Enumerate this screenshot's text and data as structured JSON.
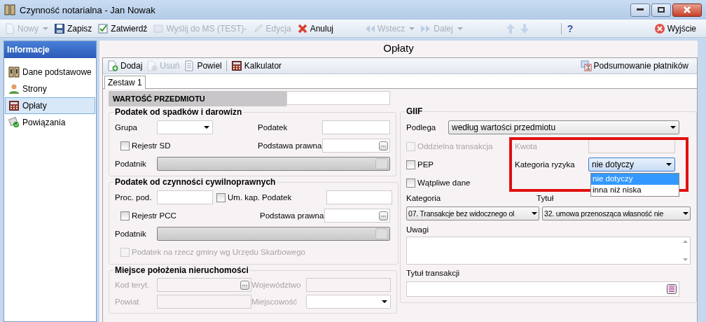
{
  "window": {
    "title": "Czynność notarialna - Jan Nowak"
  },
  "toolbar": {
    "items": [
      {
        "kind": "new",
        "label": "Nowy",
        "disabled": true,
        "dropdown": true
      },
      {
        "kind": "save",
        "label": "Zapisz",
        "disabled": false,
        "dropdown": false
      },
      {
        "kind": "approve",
        "label": "Zatwierdź",
        "disabled": false,
        "dropdown": false
      },
      {
        "kind": "send",
        "label": "Wyślij do MS (TEST)-",
        "disabled": true,
        "dropdown": false
      },
      {
        "kind": "edit",
        "label": "Edycja",
        "disabled": true,
        "dropdown": false
      },
      {
        "kind": "cancel",
        "label": "Anuluj",
        "disabled": false,
        "dropdown": false
      },
      {
        "kind": "back",
        "label": "Wstecz",
        "disabled": true,
        "dropdown": true
      },
      {
        "kind": "forward",
        "label": "Dalej",
        "disabled": true,
        "dropdown": true
      },
      {
        "kind": "up",
        "disabled": true,
        "dropdown": false
      },
      {
        "kind": "down",
        "disabled": true,
        "dropdown": false
      }
    ],
    "help": "?",
    "exit": "Wyjście"
  },
  "sidebar": {
    "title": "Informacje",
    "items": [
      {
        "kind": "docs",
        "label": "Dane podstawowe",
        "selected": false
      },
      {
        "kind": "person",
        "label": "Strony",
        "selected": false
      },
      {
        "kind": "calc",
        "label": "Opłaty",
        "selected": true
      },
      {
        "kind": "link",
        "label": "Powiązania",
        "selected": false
      }
    ]
  },
  "page": {
    "title": "Opłaty",
    "toolbar": [
      {
        "kind": "add",
        "label": "Dodaj",
        "disabled": false
      },
      {
        "kind": "remove",
        "label": "Usuń",
        "disabled": true
      },
      {
        "kind": "copy",
        "label": "Powiel",
        "disabled": false
      },
      {
        "kind": "calc",
        "label": "Kalkulator",
        "disabled": false
      }
    ],
    "summary": "Podsumowanie płatników",
    "tabs": [
      {
        "label": "Zestaw 1",
        "selected": true
      }
    ]
  },
  "subject_value": {
    "label": "WARTOŚĆ PRZEDMIOTU"
  },
  "inheritance_tax": {
    "title": "Podatek od spadków i darowizn",
    "group_label": "Grupa",
    "tax_label": "Podatek",
    "register": {
      "label": "Rejestr SD",
      "checked": false
    },
    "legal_basis_label": "Podstawa prawna",
    "taxpayer_label": "Podatnik"
  },
  "civil_tax": {
    "title": "Podatek od czynności cywilnoprawnych",
    "rate_label": "Proc. pod.",
    "capital": {
      "label": "Um. kap.",
      "checked": false
    },
    "tax_label": "Podatek",
    "register": {
      "label": "Rejestr PCC",
      "checked": false
    },
    "legal_basis_label": "Podstawa prawna",
    "taxpayer_label": "Podatnik",
    "municipality": {
      "label": "Podatek na rzecz gminy wg Urzędu Skarbowego",
      "checked": false,
      "disabled": true
    }
  },
  "property_location": {
    "title": "Miejsce położenia nieruchomości",
    "disabled": true,
    "code_label": "Kod teryt.",
    "province_label": "Województwo",
    "district_label": "Powiat",
    "town_label": "Miejscowość"
  },
  "giif": {
    "title": "GIIF",
    "subject_label": "Podlega",
    "subject_value": "według wartości przedmiotu",
    "separate": {
      "label": "Oddzielna transakcja",
      "checked": false,
      "disabled": true
    },
    "amount_label": "Kwota",
    "amount_disabled": true,
    "pep": {
      "label": "PEP",
      "checked": false,
      "disabled": false
    },
    "doubtful": {
      "label": "Wątpliwe dane",
      "checked": false,
      "disabled": false
    },
    "risk": {
      "label": "Kategoria ryzyka",
      "value": "nie dotyczy",
      "expanded": true,
      "highlighted": true,
      "options": [
        {
          "label": "nie dotyczy",
          "selected": true
        },
        {
          "label": "inna niż niska",
          "selected": false
        }
      ]
    },
    "category_label": "Kategoria",
    "category_value": "07. Transakcje bez widocznego ol",
    "title_label": "Tytuł",
    "title_value": "32. umowa przenosząca własność nie",
    "notes_label": "Uwagi",
    "transaction_title_label": "Tytuł transakcji"
  }
}
